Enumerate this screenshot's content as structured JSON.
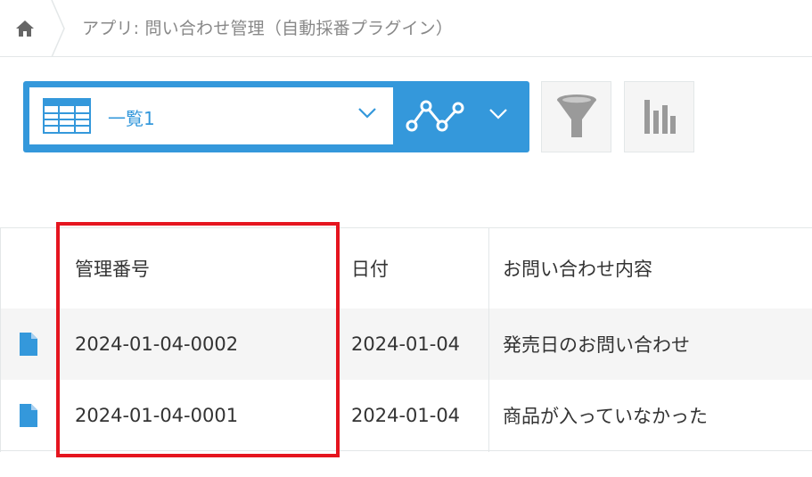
{
  "breadcrumb": {
    "home_icon": "home-icon",
    "app_label": "アプリ: 問い合わせ管理（自動採番プラグイン）"
  },
  "view_selector": {
    "view_name": "一覧1",
    "view_icon": "table-view-icon",
    "graph_icon": "line-graph-icon"
  },
  "toolbar": {
    "filter_icon": "filter-icon",
    "chart_icon": "bar-chart-icon"
  },
  "table": {
    "headers": [
      "管理番号",
      "日付",
      "お問い合わせ内容"
    ],
    "rows": [
      {
        "number": "2024-01-04-0002",
        "date": "2024-01-04",
        "content": "発売日のお問い合わせ"
      },
      {
        "number": "2024-01-04-0001",
        "date": "2024-01-04",
        "content": "商品が入っていなかった"
      }
    ]
  },
  "colors": {
    "accent": "#3498db",
    "highlight": "#e5151f",
    "row_alt": "#f5f5f5"
  }
}
